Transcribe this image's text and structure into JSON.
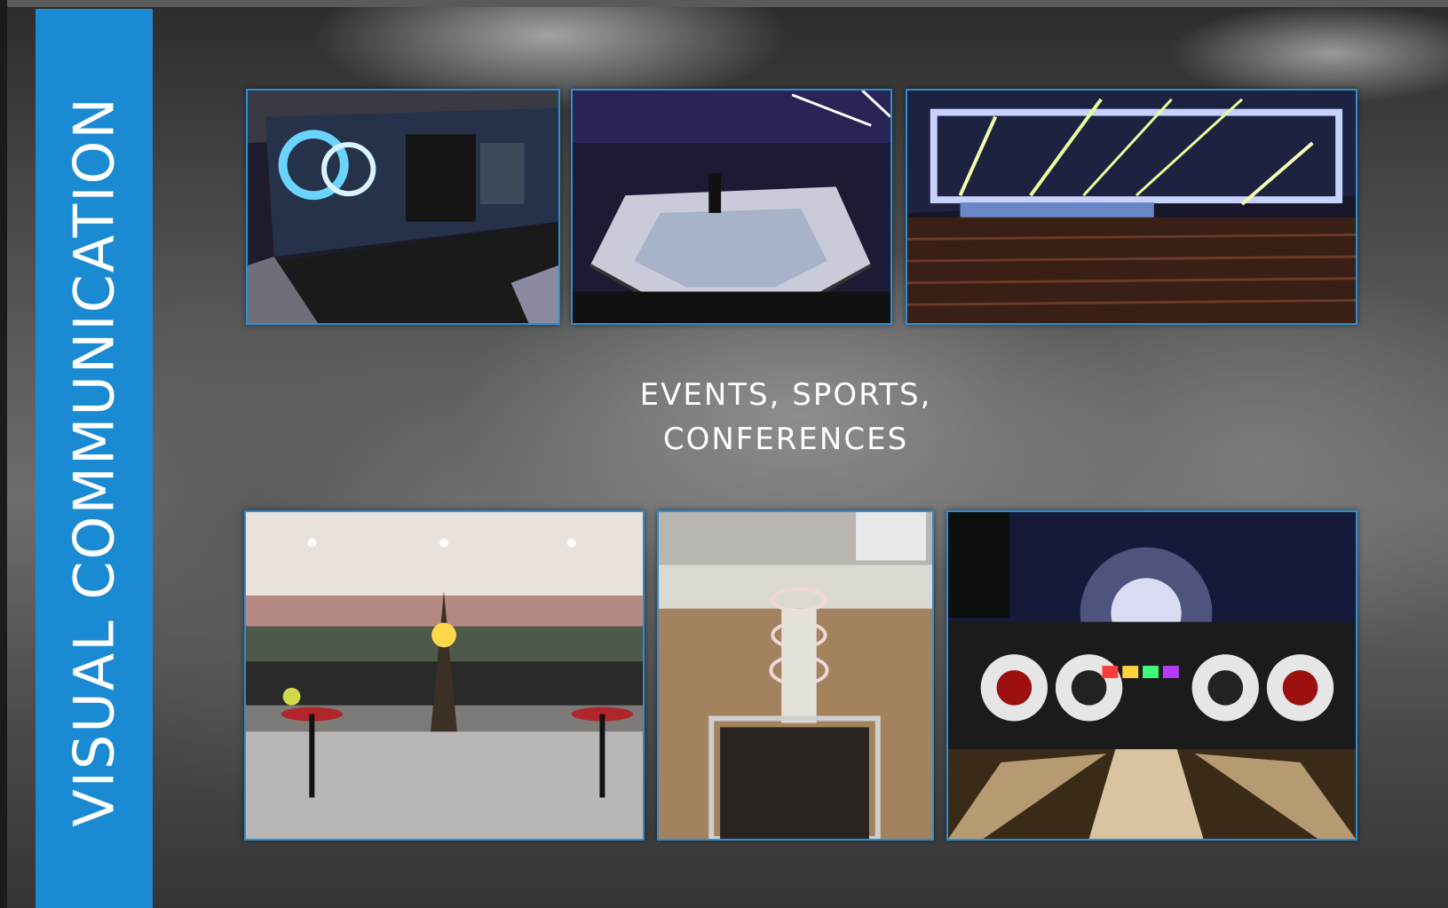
{
  "side_title": "VISUAL COMMUNICATION",
  "center_title": {
    "line1": "EVENTS, SPORTS,",
    "line2": "CONFERENCES"
  },
  "colors": {
    "accent_band": "#1a8ad3",
    "photo_border": "#2a8fd6",
    "title_text": "#ffffff"
  },
  "photos": {
    "top_row": [
      "stage-60-years-expertise-photo",
      "octagon-fight-cage-photo",
      "conference-hall-lights-photo"
    ],
    "bottom_row": [
      "eiffel-tower-event-photo",
      "mall-light-tunnel-photo",
      "outdoor-concert-stage-photo"
    ]
  }
}
